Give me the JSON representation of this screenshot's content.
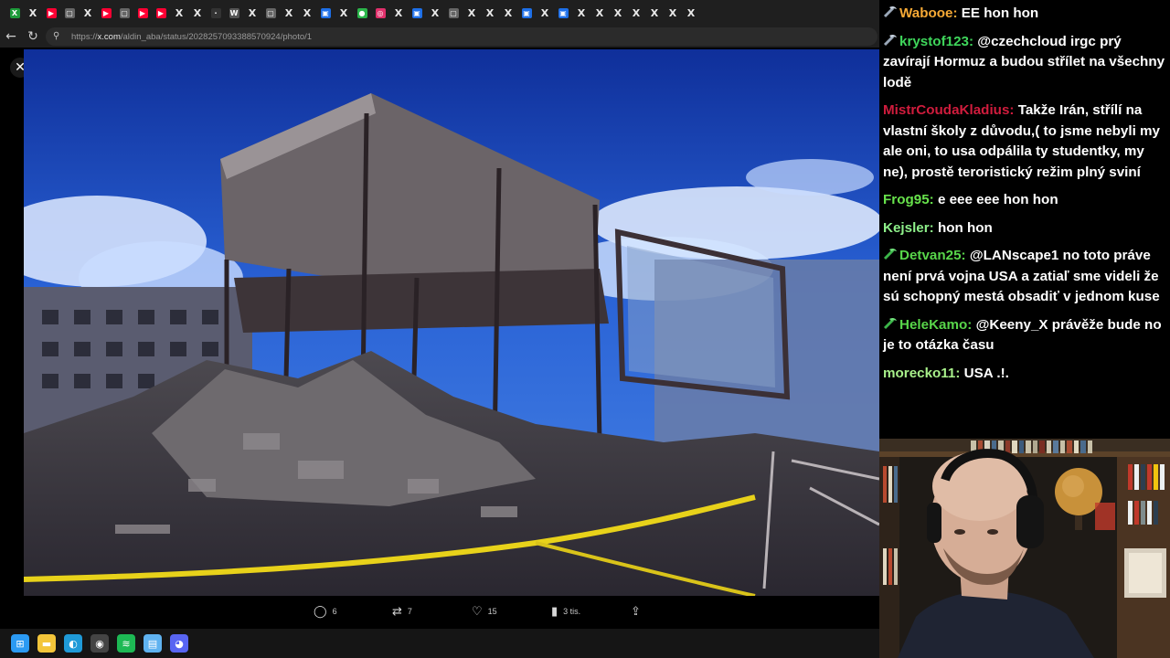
{
  "browser": {
    "tabs": [
      {
        "icon": "x-logo-icon",
        "glyph": "X",
        "color": "#1d9b3a"
      },
      {
        "icon": "x-logo-icon",
        "glyph": "X",
        "color": ""
      },
      {
        "icon": "youtube-icon",
        "glyph": "▶",
        "color": "#ff0033"
      },
      {
        "icon": "generic-page-icon",
        "glyph": "▢",
        "color": "#666"
      },
      {
        "icon": "x-logo-icon",
        "glyph": "X",
        "color": ""
      },
      {
        "icon": "youtube-icon",
        "glyph": "▶",
        "color": "#ff0033"
      },
      {
        "icon": "generic-page-icon",
        "glyph": "▢",
        "color": "#666"
      },
      {
        "icon": "youtube-icon",
        "glyph": "▶",
        "color": "#ff0033"
      },
      {
        "icon": "youtube-icon",
        "glyph": "▶",
        "color": "#ff0033"
      },
      {
        "icon": "x-logo-icon",
        "glyph": "X",
        "color": ""
      },
      {
        "icon": "x-logo-icon",
        "glyph": "X",
        "color": ""
      },
      {
        "icon": "generic-page-icon",
        "glyph": "·",
        "color": "#333"
      },
      {
        "icon": "w-page-icon",
        "glyph": "W",
        "color": "#555"
      },
      {
        "icon": "x-logo-icon",
        "glyph": "X",
        "color": ""
      },
      {
        "icon": "generic-page-icon",
        "glyph": "▢",
        "color": "#666"
      },
      {
        "icon": "x-logo-icon",
        "glyph": "X",
        "color": ""
      },
      {
        "icon": "x-logo-icon",
        "glyph": "X",
        "color": ""
      },
      {
        "icon": "blue-page-icon",
        "glyph": "▣",
        "color": "#1d6fe8"
      },
      {
        "icon": "x-logo-icon",
        "glyph": "X",
        "color": ""
      },
      {
        "icon": "green-circle-icon",
        "glyph": "●",
        "color": "#2bb54a"
      },
      {
        "icon": "instagram-icon",
        "glyph": "◎",
        "color": "#e1306c"
      },
      {
        "icon": "x-logo-icon",
        "glyph": "X",
        "color": ""
      },
      {
        "icon": "blue-page-icon",
        "glyph": "▣",
        "color": "#1d6fe8"
      },
      {
        "icon": "x-logo-icon",
        "glyph": "X",
        "color": ""
      },
      {
        "icon": "generic-page-icon",
        "glyph": "▢",
        "color": "#666"
      },
      {
        "icon": "x-logo-icon",
        "glyph": "X",
        "color": ""
      },
      {
        "icon": "x-logo-icon",
        "glyph": "X",
        "color": ""
      },
      {
        "icon": "x-logo-icon",
        "glyph": "X",
        "color": ""
      },
      {
        "icon": "blue-page-icon",
        "glyph": "▣",
        "color": "#1d6fe8"
      },
      {
        "icon": "x-logo-icon",
        "glyph": "X",
        "color": ""
      },
      {
        "icon": "blue-page-icon",
        "glyph": "▣",
        "color": "#1d6fe8"
      },
      {
        "icon": "x-logo-icon",
        "glyph": "X",
        "color": ""
      },
      {
        "icon": "x-logo-icon",
        "glyph": "X",
        "color": ""
      },
      {
        "icon": "x-logo-icon",
        "glyph": "X",
        "color": ""
      },
      {
        "icon": "x-logo-icon",
        "glyph": "X",
        "color": ""
      },
      {
        "icon": "x-logo-icon",
        "glyph": "X",
        "color": ""
      },
      {
        "icon": "x-logo-icon",
        "glyph": "X",
        "color": ""
      },
      {
        "icon": "x-logo-icon",
        "glyph": "X",
        "color": ""
      }
    ],
    "url_prefix": "https://",
    "url_domain": "x.com",
    "url_path": "/aldin_aba/status/2028257093388570924/photo/1"
  },
  "post_actions": {
    "replies": "6",
    "reposts": "7",
    "likes": "15",
    "views": "3 tis."
  },
  "taskbar": [
    {
      "icon": "windows-start-icon",
      "glyph": "⊞",
      "color": "#2b9af3"
    },
    {
      "icon": "file-explorer-icon",
      "glyph": "▬",
      "color": "#f3c53a"
    },
    {
      "icon": "edge-browser-icon",
      "glyph": "◐",
      "color": "#1f9ad8"
    },
    {
      "icon": "obs-icon",
      "glyph": "◉",
      "color": "#444"
    },
    {
      "icon": "spotify-icon",
      "glyph": "≋",
      "color": "#1db954"
    },
    {
      "icon": "notepad-icon",
      "glyph": "▤",
      "color": "#5fb2f0"
    },
    {
      "icon": "discord-icon",
      "glyph": "◕",
      "color": "#5865f2"
    }
  ],
  "chat": {
    "messages": [
      {
        "user": "Wabooe:",
        "text": "EE hon hon",
        "color": "#f6a935",
        "badge": "pickaxe-badge-icon"
      },
      {
        "user": "krystof123:",
        "text": "@czechcloud irgc prý zavírají Hormuz a budou střílet na všechny lodě",
        "color": "#3fd65b",
        "badge": "pickaxe-badge-icon"
      },
      {
        "user": "MistrCoudaKladius:",
        "text": "Takže Irán, střílí na vlastní školy z důvodu,( to jsme nebyli my ale oni, to usa odpálila ty studentky, my ne), prostě teroristický režim plný sviní",
        "color": "#d01c3d",
        "badge": ""
      },
      {
        "user": "Frog95:",
        "text": "e eee eee hon hon",
        "color": "#68e34c",
        "badge": ""
      },
      {
        "user": "Kejsler:",
        "text": "hon hon",
        "color": "#8ef08a",
        "badge": ""
      },
      {
        "user": "Detvan25:",
        "text": "@LANscape1 no toto práve není prvá vojna USA a zatiaľ sme videli že sú schopný mestá obsadiť v jednom kuse",
        "color": "#58d64a",
        "badge": "green-badge-icon"
      },
      {
        "user": "HeleKamo:",
        "text": "@Keeny_X právěže bude no je to otázka času",
        "color": "#58d64a",
        "badge": "green-badge-icon"
      },
      {
        "user": "morecko11:",
        "text": "USA .!.",
        "color": "#a8f08a",
        "badge": ""
      }
    ]
  }
}
